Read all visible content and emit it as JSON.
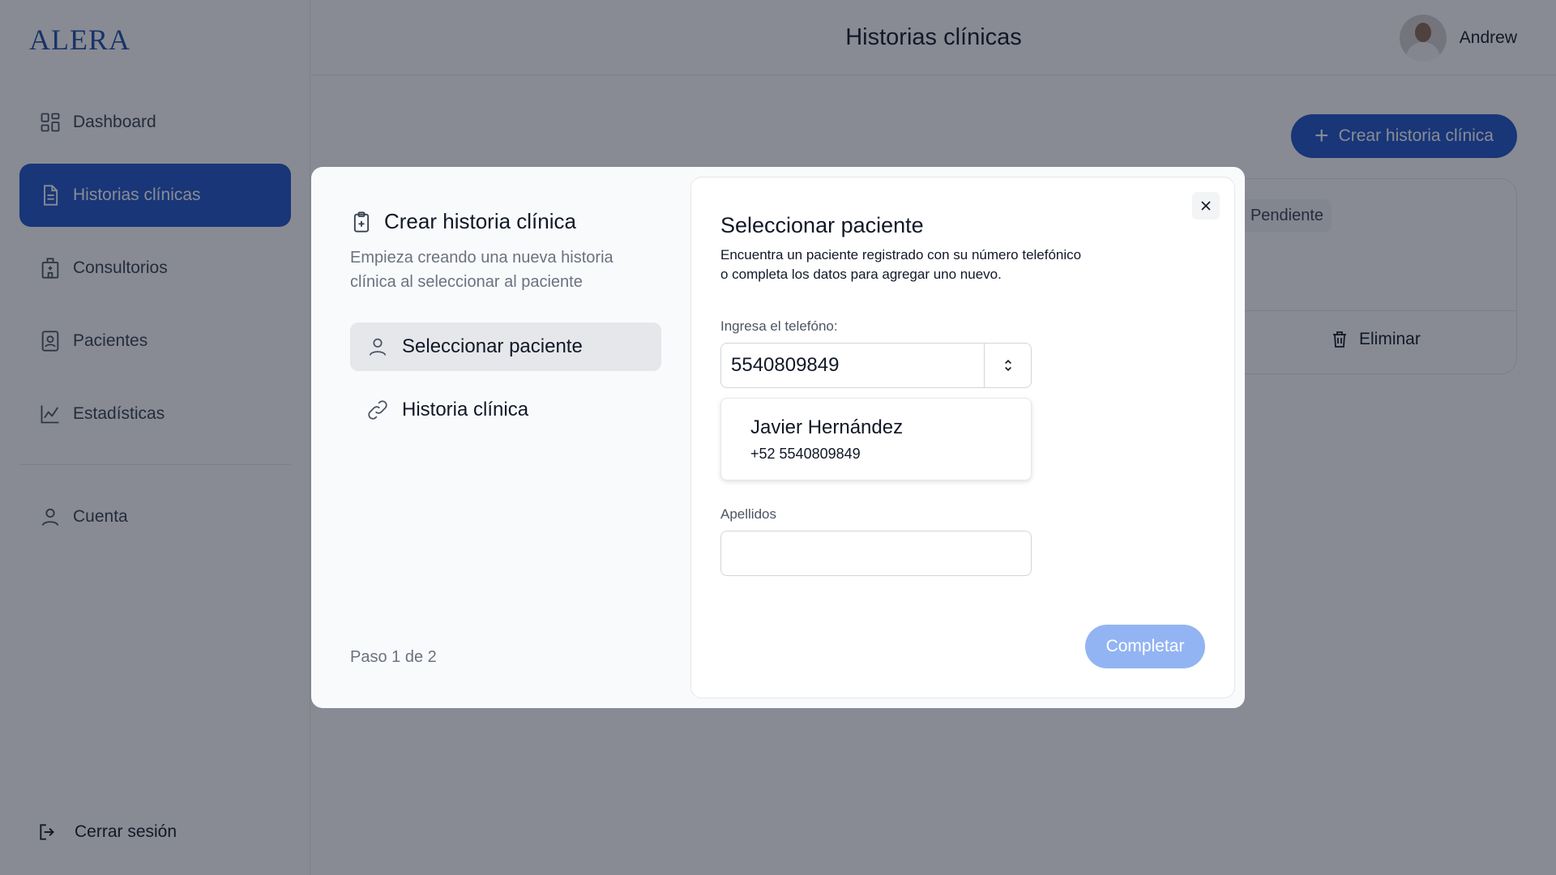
{
  "app": {
    "logo": "ALERA",
    "page_title": "Historias clínicas",
    "user_name": "Andrew"
  },
  "sidebar": {
    "items": [
      {
        "label": "Dashboard",
        "icon": "grid-icon"
      },
      {
        "label": "Historias clínicas",
        "icon": "document-icon",
        "active": true
      },
      {
        "label": "Consultorios",
        "icon": "building-icon"
      },
      {
        "label": "Pacientes",
        "icon": "contact-card-icon"
      },
      {
        "label": "Estadísticas",
        "icon": "line-chart-icon"
      },
      {
        "label": "Cuenta",
        "icon": "user-icon"
      }
    ],
    "logout_label": "Cerrar sesión"
  },
  "main": {
    "create_button_label": "Crear historia clínica",
    "card": {
      "status_badge": "Pendiente",
      "delete_label": "Eliminar"
    }
  },
  "modal": {
    "title": "Crear historia clínica",
    "subtitle": "Empieza creando una nueva historia clínica al seleccionar al paciente",
    "steps": [
      {
        "label": "Seleccionar paciente",
        "icon": "user-icon",
        "active": true
      },
      {
        "label": "Historia clínica",
        "icon": "link-icon",
        "active": false
      }
    ],
    "step_counter": "Paso 1 de 2",
    "panel": {
      "title": "Seleccionar paciente",
      "description_line1": "Encuentra un paciente registrado con su número telefónico",
      "description_line2": "o completa los datos para agregar uno nuevo.",
      "phone_label": "Ingresa el telefóno:",
      "phone_value": "5540809849",
      "suggestion": {
        "name": "Javier Hernández",
        "phone": "+52 5540809849"
      },
      "lastname_label": "Apellidos",
      "lastname_value": "",
      "complete_button": "Completar"
    }
  },
  "colors": {
    "accent": "#1e55c9",
    "accent_disabled": "#93b4f2",
    "overlay": "rgba(17,24,39,0.5)"
  }
}
